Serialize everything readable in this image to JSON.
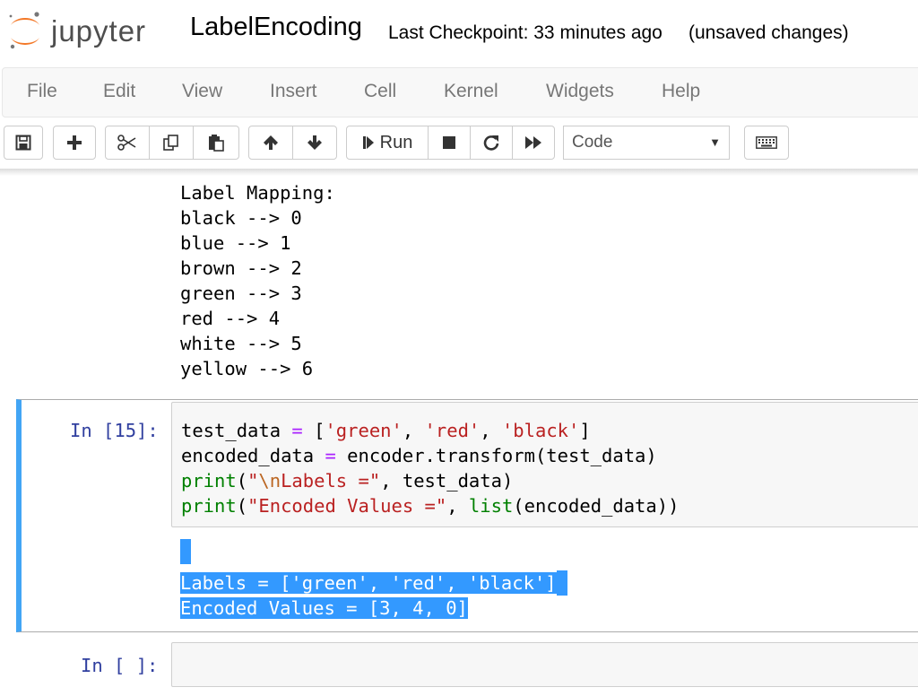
{
  "header": {
    "logo_text": "jupyter",
    "notebook_title": "LabelEncoding",
    "checkpoint": "Last Checkpoint: 33 minutes ago",
    "save_status": "(unsaved changes)"
  },
  "menubar": {
    "items": [
      "File",
      "Edit",
      "View",
      "Insert",
      "Cell",
      "Kernel",
      "Widgets",
      "Help"
    ]
  },
  "toolbar": {
    "run_label": "Run",
    "cell_type": "Code",
    "icons": [
      "save-icon",
      "plus-icon",
      "scissors-icon",
      "copy-icon",
      "paste-icon",
      "arrow-up-icon",
      "arrow-down-icon",
      "step-forward-icon",
      "stop-icon",
      "restart-icon",
      "fast-forward-icon",
      "keyboard-icon"
    ]
  },
  "cells": {
    "previous_output": {
      "lines": [
        "Label Mapping:",
        "black --> 0",
        "blue --> 1",
        "brown --> 2",
        "green --> 3",
        "red --> 4",
        "white --> 5",
        "yellow --> 6"
      ]
    },
    "cell15": {
      "prompt": "In [15]:",
      "code": {
        "l1_var": "test_data ",
        "l1_eq": "=",
        "l1_open": " [",
        "l1_s1": "'green'",
        "l1_c1": ", ",
        "l1_s2": "'red'",
        "l1_c2": ", ",
        "l1_s3": "'black'",
        "l1_close": "]",
        "l2_var": "encoded_data ",
        "l2_eq": "=",
        "l2_rest": " encoder.transform(test_data)",
        "l3_fn": "print",
        "l3_open": "(",
        "l3_s_pre": "\"",
        "l3_esc": "\\n",
        "l3_s_post": "Labels =\"",
        "l3_rest": ", test_data)",
        "l4_fn": "print",
        "l4_open": "(",
        "l4_str": "\"Encoded Values =\"",
        "l4_mid": ", ",
        "l4_fn2": "list",
        "l4_rest": "(encoded_data))"
      },
      "output": {
        "line1": "Labels = ['green', 'red', 'black']",
        "line2": "Encoded Values = [3, 4, 0]"
      }
    },
    "empty_cell": {
      "prompt": "In [ ]:"
    }
  },
  "colors": {
    "selected_cell_border": "#42a5f5",
    "prompt": "#303f9f",
    "selection": "#3399ff",
    "keyword": "#008000",
    "string": "#ba2121",
    "operator": "#aa22ff",
    "logo_orange": "#f37726"
  }
}
